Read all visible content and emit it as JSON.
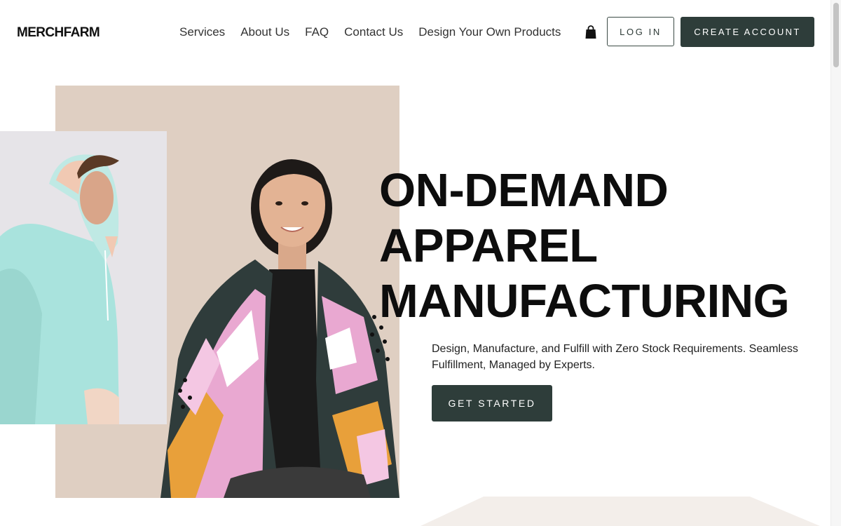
{
  "header": {
    "logo": "MERCHFARM",
    "nav": [
      {
        "label": "Services"
      },
      {
        "label": "About Us"
      },
      {
        "label": "FAQ"
      },
      {
        "label": "Contact Us"
      },
      {
        "label": "Design Your Own Products"
      }
    ],
    "cart_icon": "shopping-bag-icon",
    "login_label": "LOG IN",
    "create_account_label": "CREATE ACCOUNT"
  },
  "hero": {
    "headline_lines": [
      "ON-DEMAND",
      "APPAREL",
      "MANUFACTURING"
    ],
    "subtext": "Design, Manufacture, and Fulfill with Zero Stock Requirements. Seamless Fulfillment, Managed by Experts.",
    "cta_label": "GET STARTED"
  },
  "colors": {
    "accent": "#2e3d3a",
    "beige_panel": "#dfcfc2",
    "grey_panel": "#e6e4e8",
    "hoodie": "#a9e3dd"
  }
}
